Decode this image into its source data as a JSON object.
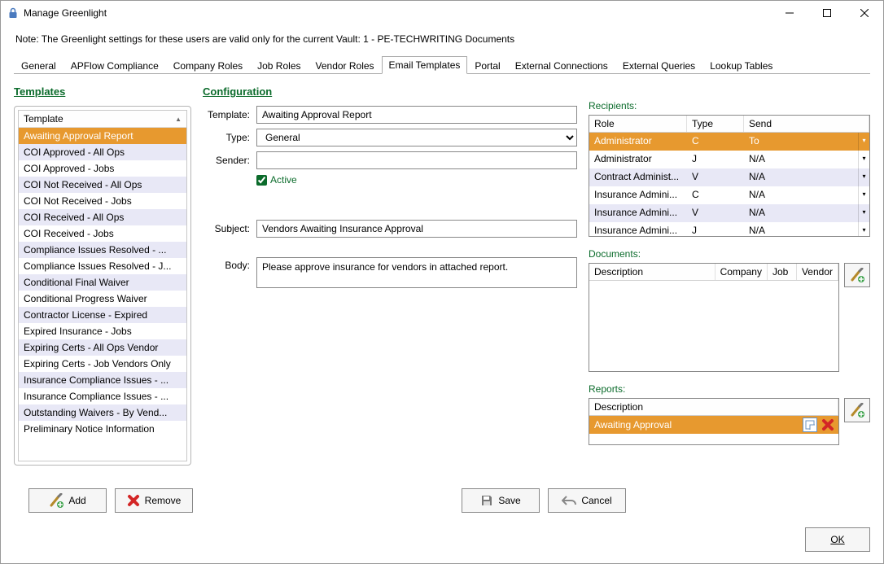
{
  "window": {
    "title": "Manage Greenlight"
  },
  "note": "Note:  The Greenlight settings for these users are valid only for the current Vault: 1 - PE-TECHWRITING Documents",
  "tabs": [
    {
      "label": "General"
    },
    {
      "label": "APFlow Compliance"
    },
    {
      "label": "Company Roles"
    },
    {
      "label": "Job Roles"
    },
    {
      "label": "Vendor Roles"
    },
    {
      "label": "Email Templates",
      "active": true
    },
    {
      "label": "Portal"
    },
    {
      "label": "External Connections"
    },
    {
      "label": "External Queries"
    },
    {
      "label": "Lookup Tables"
    }
  ],
  "left": {
    "heading": "Templates",
    "column": "Template",
    "items": [
      "Awaiting Approval Report",
      "COI Approved - All Ops",
      "COI Approved - Jobs",
      "COI Not Received - All Ops",
      "COI Not Received - Jobs",
      "COI Received - All Ops",
      "COI Received - Jobs",
      "Compliance Issues Resolved - ...",
      "Compliance Issues Resolved - J...",
      "Conditional Final Waiver",
      "Conditional Progress Waiver",
      "Contractor License - Expired",
      "Expired Insurance - Jobs",
      "Expiring Certs - All Ops Vendor",
      "Expiring Certs - Job Vendors Only",
      "Insurance Compliance Issues - ...",
      "Insurance Compliance Issues - ...",
      "Outstanding Waivers - By Vend...",
      "Preliminary Notice Information"
    ],
    "selectedIndex": 0
  },
  "config": {
    "heading": "Configuration",
    "labels": {
      "template": "Template:",
      "type": "Type:",
      "sender": "Sender:",
      "active": "Active",
      "subject": "Subject:",
      "body": "Body:"
    },
    "values": {
      "template": "Awaiting Approval Report",
      "type": "General",
      "sender": "",
      "active": true,
      "subject": "Vendors Awaiting Insurance Approval",
      "body": "Please approve insurance for vendors in attached report."
    }
  },
  "recipients": {
    "label": "Recipients:",
    "columns": {
      "role": "Role",
      "type": "Type",
      "send": "Send"
    },
    "rows": [
      {
        "role": "Administrator",
        "type": "C",
        "send": "To",
        "sel": true
      },
      {
        "role": "Administrator",
        "type": "J",
        "send": "N/A"
      },
      {
        "role": "Contract Administ...",
        "type": "V",
        "send": "N/A"
      },
      {
        "role": "Insurance Admini...",
        "type": "C",
        "send": "N/A"
      },
      {
        "role": "Insurance Admini...",
        "type": "V",
        "send": "N/A"
      },
      {
        "role": "Insurance Admini...",
        "type": "J",
        "send": "N/A"
      }
    ]
  },
  "documents": {
    "label": "Documents:",
    "columns": {
      "desc": "Description",
      "company": "Company",
      "job": "Job",
      "vendor": "Vendor"
    }
  },
  "reports": {
    "label": "Reports:",
    "columns": {
      "desc": "Description"
    },
    "rows": [
      {
        "desc": "Awaiting Approval"
      }
    ]
  },
  "buttons": {
    "add": "Add",
    "remove": "Remove",
    "save": "Save",
    "cancel": "Cancel",
    "ok": "OK"
  }
}
